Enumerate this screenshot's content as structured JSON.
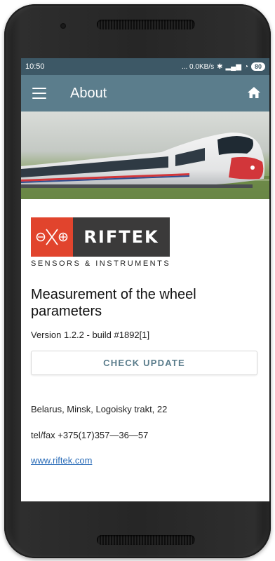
{
  "status": {
    "time": "10:50",
    "network": "... 0.0KB/s",
    "battery": "80"
  },
  "appbar": {
    "title": "About"
  },
  "logo": {
    "name": "RIFTEK",
    "tagline": "SENSORS & INSTRUMENTS"
  },
  "about": {
    "heading": "Measurement of the wheel parameters",
    "version": "Version 1.2.2 - build #1892[1]",
    "check_update_label": "CHECK UPDATE",
    "address": "Belarus, Minsk, Logoisky trakt, 22",
    "phone": "tel/fax +375(17)357—36—57",
    "website": "www.riftek.com"
  },
  "colors": {
    "appbar": "#5b7d8c",
    "statusbar": "#3d5866",
    "accent_text": "#5b7d8c",
    "link": "#2a6cb8",
    "logo_red": "#e1442d",
    "logo_dark": "#3b3a3a"
  },
  "icons": {
    "menu": "hamburger-icon",
    "home": "home-icon",
    "bluetooth": "bluetooth-icon",
    "signal": "signal-icon",
    "wifi": "wifi-icon",
    "battery": "battery-icon"
  }
}
